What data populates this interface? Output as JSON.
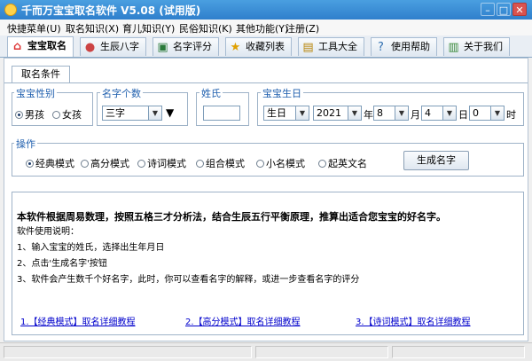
{
  "window": {
    "title": "千而万宝宝取名软件 V5.08 (试用版)"
  },
  "menu": [
    "快捷菜单(U)",
    "取名知识(X)",
    "育儿知识(Y)",
    "民俗知识(K)",
    "其他功能(Y)",
    "注册(Z)"
  ],
  "tabs": [
    {
      "label": "宝宝取名",
      "icon": "house-icon"
    },
    {
      "label": "生辰八字",
      "icon": "baby-icon"
    },
    {
      "label": "名字评分",
      "icon": "card-icon"
    },
    {
      "label": "收藏列表",
      "icon": "star-icon"
    },
    {
      "label": "工具大全",
      "icon": "notebook-icon"
    },
    {
      "label": "使用帮助",
      "icon": "help-icon"
    },
    {
      "label": "关于我们",
      "icon": "chart-icon"
    }
  ],
  "subtab": "取名条件",
  "gender": {
    "label": "宝宝性别",
    "options": [
      "男孩",
      "女孩"
    ],
    "selected": "男孩"
  },
  "name_length": {
    "label": "名字个数",
    "value": "三字",
    "marker": "▼"
  },
  "surname": {
    "label": "姓氏",
    "value": ""
  },
  "birth": {
    "label": "宝宝生日",
    "calendar": "生日",
    "year": "2021",
    "year_unit": "年",
    "month": "8",
    "month_unit": "月",
    "day": "4",
    "day_unit": "日",
    "hour": "0",
    "hour_unit": "时"
  },
  "operation": {
    "label": "操作",
    "modes": [
      "经典模式",
      "高分模式",
      "诗词模式",
      "组合模式",
      "小名模式",
      "起英文名"
    ],
    "selected": "经典模式",
    "generate_label": "生成名字"
  },
  "description": {
    "headline": "本软件根据周易数理，按照五格三才分析法，结合生辰五行平衡原理，推算出适合您宝宝的好名字。",
    "usage_title": "软件使用说明：",
    "steps": [
      "1、输入宝宝的姓氏，选择出生年月日",
      "2、点击'生成名字'按钮",
      "3、软件会产生数千个好名字，此时，你可以查看名字的解释，或进一步查看名字的评分"
    ],
    "links": [
      "1.【经典模式】取名详细教程",
      "2.【高分模式】取名详细教程",
      "3.【诗词模式】取名详细教程"
    ]
  },
  "colors": {
    "title_bg": "#2f7fcc",
    "group_label": "#1f5fae",
    "link": "#0000cc"
  }
}
